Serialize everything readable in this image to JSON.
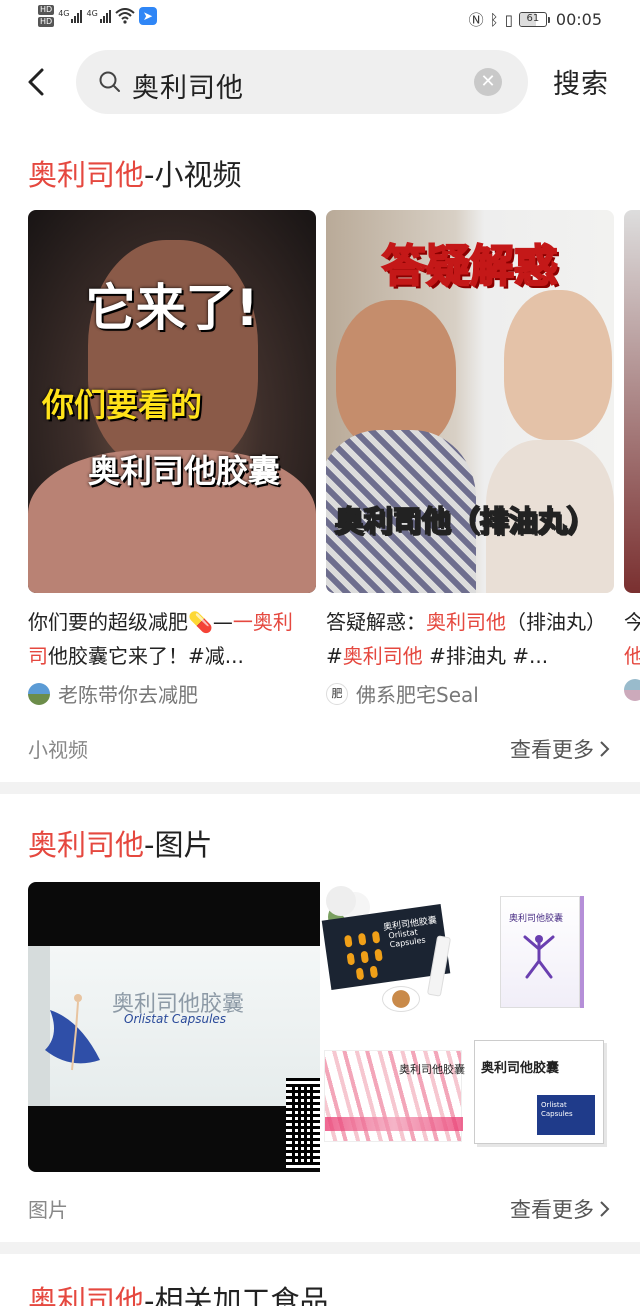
{
  "status_bar": {
    "hd_badges": [
      "HD",
      "HD"
    ],
    "network": [
      "4G",
      "4G"
    ],
    "battery_level": "61",
    "battery_fraction": 0.61,
    "time": "00:05",
    "icons": [
      "nfc-icon",
      "bluetooth-icon",
      "vibrate-icon",
      "wifi-icon",
      "app-notification-icon"
    ]
  },
  "search": {
    "query": "奥利司他",
    "search_button": "搜索"
  },
  "sections": [
    {
      "title_highlight": "奥利司他",
      "title_rest": "-小视频",
      "videos": [
        {
          "overlay_lines": [
            "它来了!",
            "你们要看的",
            "奥利司他胶囊"
          ],
          "desc_parts": [
            {
              "t": "你们要的超级减肥💊—",
              "hl": false
            },
            {
              "t": "一奥利司",
              "hl": true
            },
            {
              "t": "他胶囊它来了！#减...",
              "hl": false
            }
          ],
          "author": "老陈带你去减肥"
        },
        {
          "overlay_lines": [
            "答疑解惑",
            "奥利司他（排油丸）"
          ],
          "desc_parts": [
            {
              "t": "答疑解惑：",
              "hl": false
            },
            {
              "t": "奥利司他",
              "hl": true
            },
            {
              "t": "（排油丸）#",
              "hl": false
            },
            {
              "t": "奥利司他",
              "hl": true
            },
            {
              "t": " #排油丸 #...",
              "hl": false
            }
          ],
          "author": "佛系肥宅Seal"
        },
        {
          "overlay_lines": [],
          "desc_parts": [
            {
              "t": "今",
              "hl": false
            },
            {
              "t": "他",
              "hl": true
            }
          ],
          "author": ""
        }
      ],
      "footer_label": "小视频",
      "more_label": "查看更多"
    },
    {
      "title_highlight": "奥利司他",
      "title_rest": "-图片",
      "images": {
        "big": {
          "title": "奥利司他胶囊",
          "subtitle": "Orlistat Capsules"
        },
        "small": [
          {
            "text": "奥利司他胶囊",
            "subtitle": "Orlistat Capsules"
          },
          {
            "text": "奥利司他胶囊"
          },
          {
            "text": "奥利司他胶囊"
          },
          {
            "text": "奥利司他胶囊",
            "subtitle": "Orlistat Capsules"
          }
        ]
      },
      "footer_label": "图片",
      "more_label": "查看更多"
    },
    {
      "title_highlight": "奥利司他",
      "title_rest": "-相关加工食品"
    }
  ]
}
